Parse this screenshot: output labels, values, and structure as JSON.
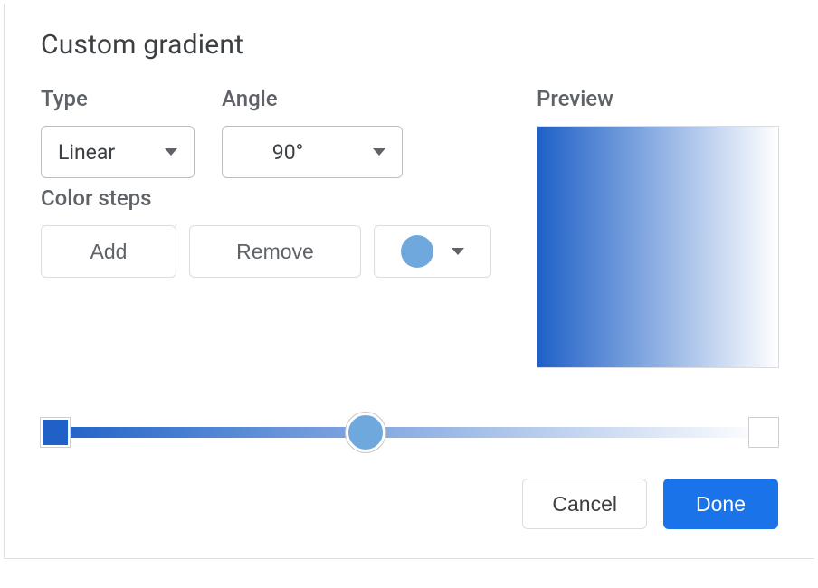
{
  "dialog": {
    "title": "Custom gradient"
  },
  "type": {
    "label": "Type",
    "value": "Linear"
  },
  "angle": {
    "label": "Angle",
    "value": "90°"
  },
  "preview": {
    "label": "Preview"
  },
  "color_steps": {
    "label": "Color steps",
    "add_label": "Add",
    "remove_label": "Remove",
    "selected_color": "#6fa8dc"
  },
  "gradient": {
    "start_color": "#1f61c7",
    "end_color": "#ffffff",
    "thumb_color": "#6fa8dc",
    "thumb_position_pct": 44
  },
  "footer": {
    "cancel_label": "Cancel",
    "done_label": "Done",
    "done_bg": "#1a73e8"
  }
}
